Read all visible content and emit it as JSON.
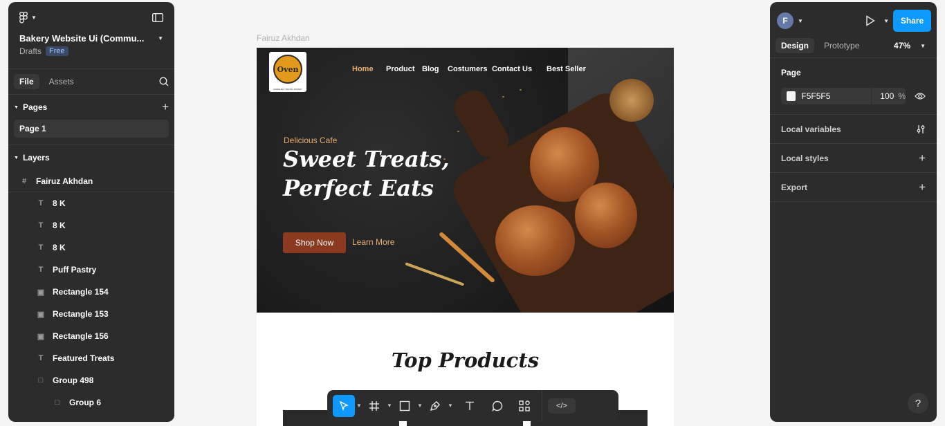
{
  "file": {
    "title": "Bakery Website Ui (Commu...",
    "location": "Drafts",
    "plan_badge": "Free"
  },
  "left_tabs": {
    "file": "File",
    "assets": "Assets"
  },
  "pages": {
    "heading": "Pages",
    "items": [
      {
        "label": "Page 1"
      }
    ]
  },
  "layers": {
    "heading": "Layers",
    "items": [
      {
        "label": "Fairuz Akhdan",
        "icon": "frame-icon",
        "indent": 0
      },
      {
        "label": "8 K",
        "icon": "text-icon",
        "indent": 1
      },
      {
        "label": "8 K",
        "icon": "text-icon",
        "indent": 1
      },
      {
        "label": "8 K",
        "icon": "text-icon",
        "indent": 1
      },
      {
        "label": "Puff Pastry",
        "icon": "text-icon",
        "indent": 1
      },
      {
        "label": "Rectangle 154",
        "icon": "image-icon",
        "indent": 1
      },
      {
        "label": "Rectangle 153",
        "icon": "image-icon",
        "indent": 1
      },
      {
        "label": "Rectangle 156",
        "icon": "image-icon",
        "indent": 1
      },
      {
        "label": "Featured Treats",
        "icon": "text-icon",
        "indent": 1
      },
      {
        "label": "Group 498",
        "icon": "group-icon",
        "indent": 1
      },
      {
        "label": "Group 6",
        "icon": "group-icon",
        "indent": 2
      }
    ]
  },
  "canvas": {
    "frame_label": "Fairuz Akhdan",
    "site": {
      "logo_text": "Oven",
      "logo_subtext": "DANIELBAY BAKING FRENZY",
      "nav": [
        "Home",
        "Product",
        "Blog",
        "Costumers",
        "Contact Us",
        "Best Seller"
      ],
      "kicker": "Delicious Cafe",
      "headline_line1": "Sweet Treats,",
      "headline_line2": "Perfect Eats",
      "shop_button": "Shop Now",
      "learn_link": "Learn More",
      "section_title": "Top Products"
    }
  },
  "toolbar": {
    "tools": [
      "move-tool",
      "frame-tool",
      "shape-tool",
      "pen-tool",
      "text-tool",
      "comment-tool",
      "actions-tool"
    ],
    "dev_mode": "</>"
  },
  "right": {
    "avatar_initial": "F",
    "share_label": "Share",
    "tabs": {
      "design": "Design",
      "prototype": "Prototype"
    },
    "zoom": "47%",
    "page_section": "Page",
    "page_fill_hex": "F5F5F5",
    "page_fill_opacity": "100",
    "percent_sign": "%",
    "local_variables": "Local variables",
    "local_styles": "Local styles",
    "export": "Export",
    "help": "?"
  },
  "colors": {
    "accent": "#0d99ff",
    "panel": "#2c2c2c",
    "canvas_bg": "#f5f5f5",
    "nav_active": "#e7b074",
    "shop_button": "#8b3a1f"
  }
}
